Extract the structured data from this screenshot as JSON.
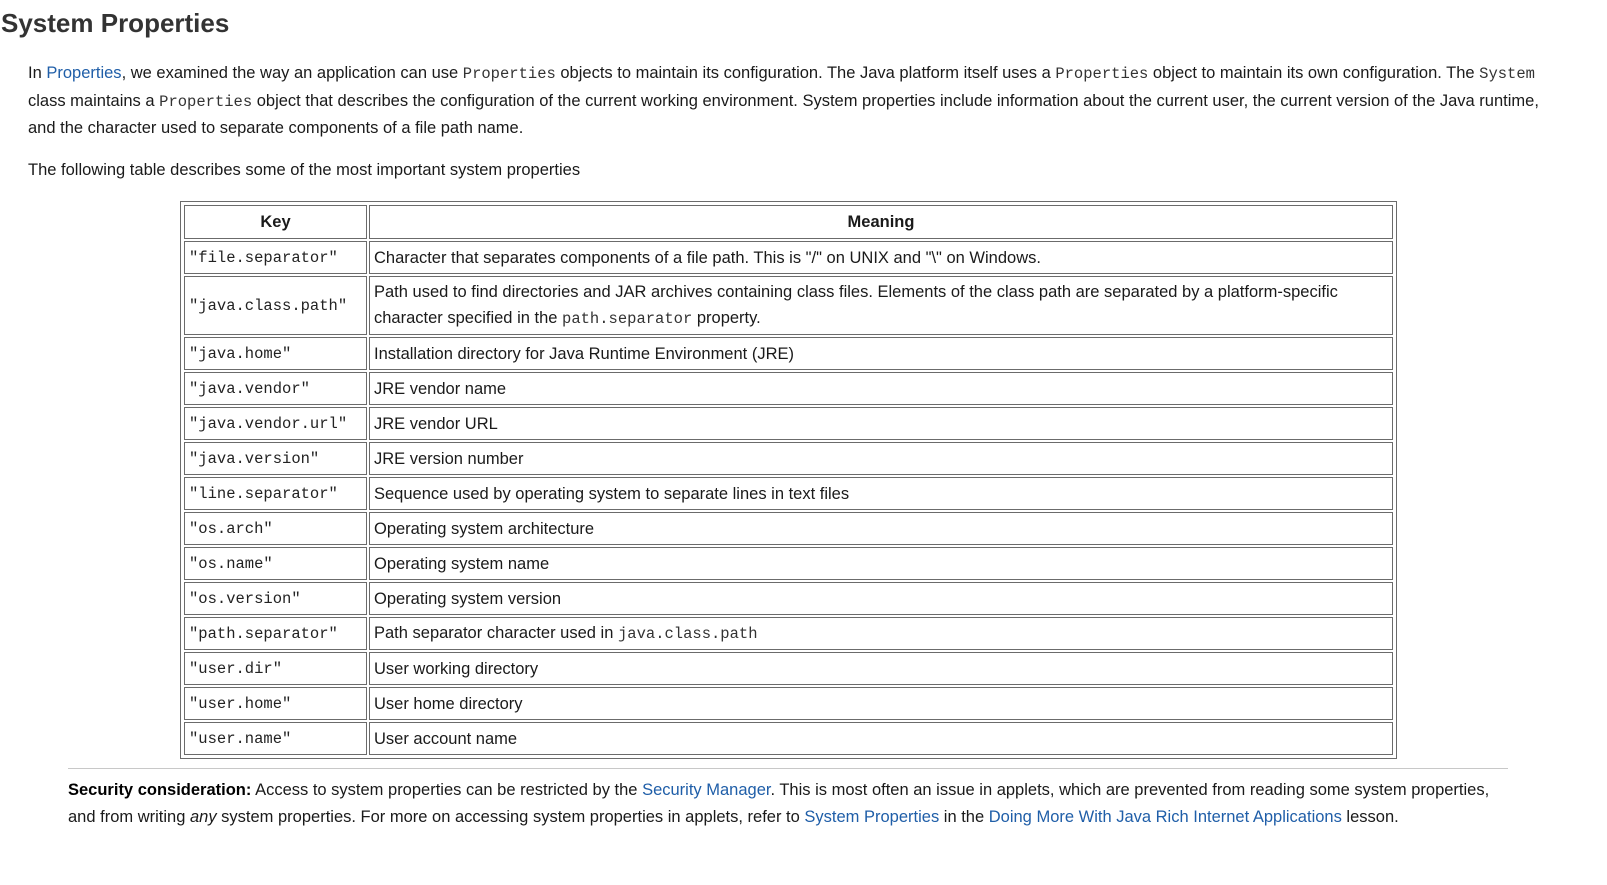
{
  "title": "System Properties",
  "intro": {
    "t1": "In ",
    "link_properties": "Properties",
    "t2": ", we examined the way an application can use ",
    "code_properties_1": "Properties",
    "t3": " objects to maintain its configuration. The Java platform itself uses a ",
    "code_properties_2": "Properties",
    "t4": " object to maintain its own configuration. The ",
    "code_system": "System",
    "t5": " class maintains a ",
    "code_properties_3": "Properties",
    "t6": " object that describes the configuration of the current working environment. System properties include information about the current user, the current version of the Java runtime, and the character used to separate components of a file path name."
  },
  "table_intro": "The following table describes some of the most important system properties",
  "table": {
    "headers": {
      "key": "Key",
      "meaning": "Meaning"
    },
    "rows": [
      {
        "key": "\"file.separator\"",
        "meaning": "Character that separates components of a file path. This is \"/\" on UNIX and \"\\\" on Windows."
      },
      {
        "key": "\"java.class.path\"",
        "meaning_pre": "Path used to find directories and JAR archives containing class files. Elements of the class path are separated by a platform-specific character specified in the ",
        "meaning_code": "path.separator",
        "meaning_post": " property."
      },
      {
        "key": "\"java.home\"",
        "meaning": "Installation directory for Java Runtime Environment (JRE)"
      },
      {
        "key": "\"java.vendor\"",
        "meaning": "JRE vendor name"
      },
      {
        "key": "\"java.vendor.url\"",
        "meaning": "JRE vendor URL"
      },
      {
        "key": "\"java.version\"",
        "meaning": "JRE version number"
      },
      {
        "key": "\"line.separator\"",
        "meaning": "Sequence used by operating system to separate lines in text files"
      },
      {
        "key": "\"os.arch\"",
        "meaning": "Operating system architecture"
      },
      {
        "key": "\"os.name\"",
        "meaning": "Operating system name"
      },
      {
        "key": "\"os.version\"",
        "meaning": "Operating system version"
      },
      {
        "key": "\"path.separator\"",
        "meaning_pre": "Path separator character used in ",
        "meaning_code": "java.class.path",
        "meaning_post": ""
      },
      {
        "key": "\"user.dir\"",
        "meaning": "User working directory"
      },
      {
        "key": "\"user.home\"",
        "meaning": "User home directory"
      },
      {
        "key": "\"user.name\"",
        "meaning": "User account name"
      }
    ]
  },
  "security": {
    "label": "Security consideration:",
    "t1": " Access to system properties can be restricted by the ",
    "link_security_manager": "Security Manager",
    "t2": ". This is most often an issue in applets, which are prevented from reading some system properties, and from writing ",
    "em_any": "any",
    "t3": " system properties. For more on accessing system properties in applets, refer to ",
    "link_system_properties": "System Properties",
    "t4": " in the ",
    "link_doing_more": "Doing More With Java Rich Internet Applications",
    "t5": " lesson."
  },
  "colors": {
    "link": "#1f5ea8",
    "title": "#333333",
    "table_border": "#6b6b6b"
  }
}
